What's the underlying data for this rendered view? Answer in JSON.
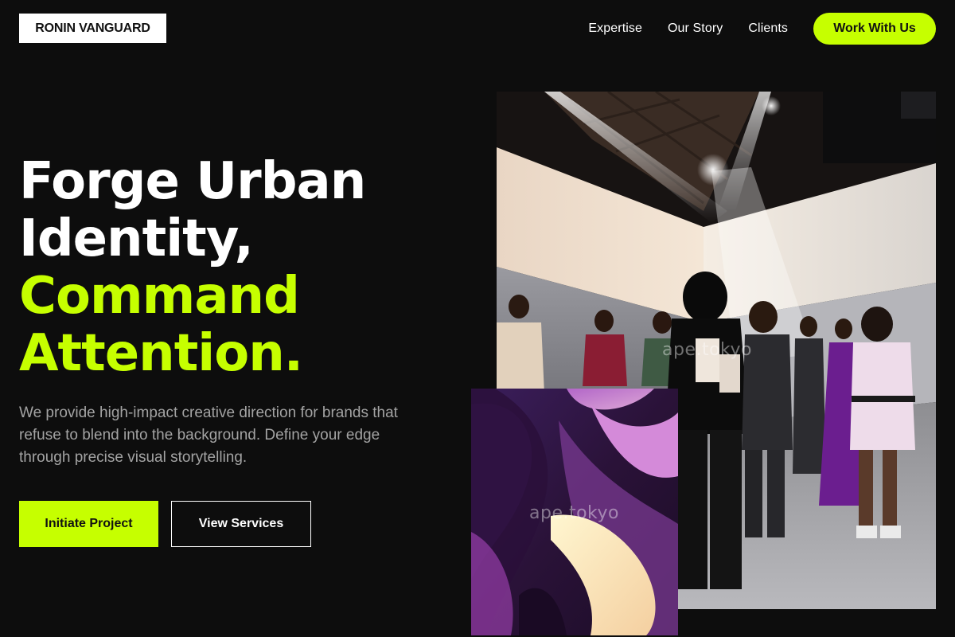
{
  "brand": {
    "logo_text": "RONIN VANGUARD"
  },
  "nav": {
    "links": [
      "Expertise",
      "Our Story",
      "Clients"
    ],
    "cta_label": "Work With Us"
  },
  "hero": {
    "title_lines": [
      "Forge Urban",
      "Identity,",
      "Command",
      "Attention."
    ],
    "description": "We provide high-impact creative direction for brands that refuse to blend into the background. Define your edge through precise visual storytelling.",
    "primary_button": "Initiate Project",
    "secondary_button": "View Services"
  },
  "images": {
    "main_watermark": "ape.tokyo",
    "abstract_watermark": "ape.tokyo"
  },
  "colors": {
    "background": "#0d0d0d",
    "accent": "#c6ff00",
    "text": "#ffffff",
    "muted_text": "#a3a3a3"
  }
}
